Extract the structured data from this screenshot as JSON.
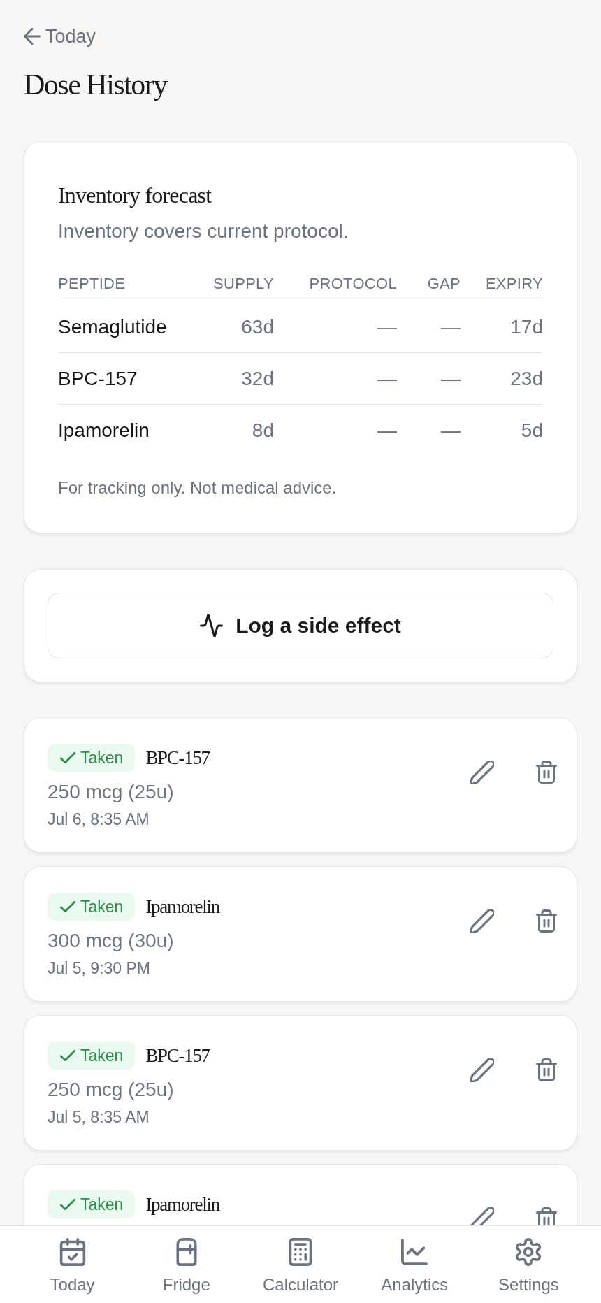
{
  "header": {
    "back_label": "Today",
    "title": "Dose History"
  },
  "inventory_forecast": {
    "title": "Inventory forecast",
    "summary": "Inventory covers current protocol.",
    "columns": [
      "PEPTIDE",
      "SUPPLY",
      "PROTOCOL",
      "GAP",
      "EXPIRY"
    ],
    "rows": [
      [
        "Semaglutide",
        "63d",
        "—",
        "—",
        "17d"
      ],
      [
        "BPC-157",
        "32d",
        "—",
        "—",
        "23d"
      ],
      [
        "Ipamorelin",
        "8d",
        "—",
        "—",
        "5d"
      ]
    ],
    "note": "For tracking only. Not medical advice."
  },
  "side_effect_button": {
    "label": "Log a side effect"
  },
  "doses": [
    {
      "status": {
        "kind": "taken",
        "label": "Taken"
      },
      "name": "BPC-157",
      "amount": "250 mcg (25u)",
      "time": "Jul 6, 8:35 AM"
    },
    {
      "status": {
        "kind": "taken",
        "label": "Taken"
      },
      "name": "Ipamorelin",
      "amount": "300 mcg (30u)",
      "time": "Jul 5, 9:30 PM"
    },
    {
      "status": {
        "kind": "taken",
        "label": "Taken"
      },
      "name": "BPC-157",
      "amount": "250 mcg (25u)",
      "time": "Jul 5, 8:35 AM"
    },
    {
      "status": {
        "kind": "taken",
        "label": "Taken"
      },
      "name": "Ipamorelin"
    }
  ],
  "bottom_nav": [
    {
      "label": "Today"
    },
    {
      "label": "Fridge"
    },
    {
      "label": "Calculator"
    },
    {
      "label": "Analytics"
    },
    {
      "label": "Settings"
    }
  ]
}
